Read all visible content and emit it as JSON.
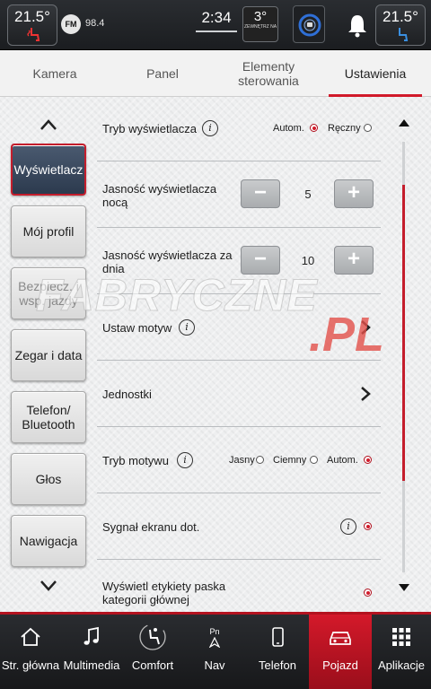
{
  "status": {
    "left_temp": "21.5°",
    "radio_band": "FM",
    "radio_freq": "98.4",
    "clock": "2:34",
    "outside_temp": "3°",
    "outside_label": "ZEWNĘTRZ NA",
    "right_temp": "21.5°"
  },
  "tabs": [
    {
      "label": "Kamera"
    },
    {
      "label": "Panel"
    },
    {
      "label": "Elementy sterowania"
    },
    {
      "label": "Ustawienia"
    }
  ],
  "side_nav": [
    {
      "label": "Wyświetlacz"
    },
    {
      "label": "Mój profil"
    },
    {
      "label": "Bezpiecz. i wsp. jazdy"
    },
    {
      "label": "Zegar i data"
    },
    {
      "label": "Telefon/ Bluetooth"
    },
    {
      "label": "Głos"
    },
    {
      "label": "Nawigacja"
    }
  ],
  "settings": {
    "display_mode": {
      "label": "Tryb wyświetlacza",
      "opt_auto": "Autom.",
      "opt_manual": "Ręczny",
      "selected": "Autom."
    },
    "night_brightness": {
      "label": "Jasność wyświetlacza nocą",
      "value": "5"
    },
    "day_brightness": {
      "label": "Jasność wyświetlacza za dnia",
      "value": "10"
    },
    "set_theme": {
      "label": "Ustaw motyw"
    },
    "units": {
      "label": "Jednostki"
    },
    "theme_mode": {
      "label": "Tryb motywu",
      "opt_light": "Jasny",
      "opt_dark": "Ciemny",
      "opt_auto": "Autom.",
      "selected": "Autom."
    },
    "touch_sound": {
      "label": "Sygnał ekranu dot.",
      "enabled": true
    },
    "category_labels": {
      "label": "Wyświetl etykiety paska kategorii głównej",
      "enabled": true
    }
  },
  "watermark": {
    "text1": "FABRYCZNE",
    "text2": ".PL"
  },
  "bottom_nav": [
    {
      "label": "Str. główna",
      "icon": "home-icon"
    },
    {
      "label": "Multimedia",
      "icon": "music-note-icon"
    },
    {
      "label": "Comfort",
      "icon": "comfort-seat-icon"
    },
    {
      "label": "Nav",
      "icon": "nav-arrow-icon",
      "icon_text": "Pn"
    },
    {
      "label": "Telefon",
      "icon": "phone-icon"
    },
    {
      "label": "Pojazd",
      "icon": "car-icon"
    },
    {
      "label": "Aplikacje",
      "icon": "apps-grid-icon"
    }
  ],
  "colors": {
    "accent": "#d11a2a",
    "active_nav": "#2c3a4e"
  }
}
